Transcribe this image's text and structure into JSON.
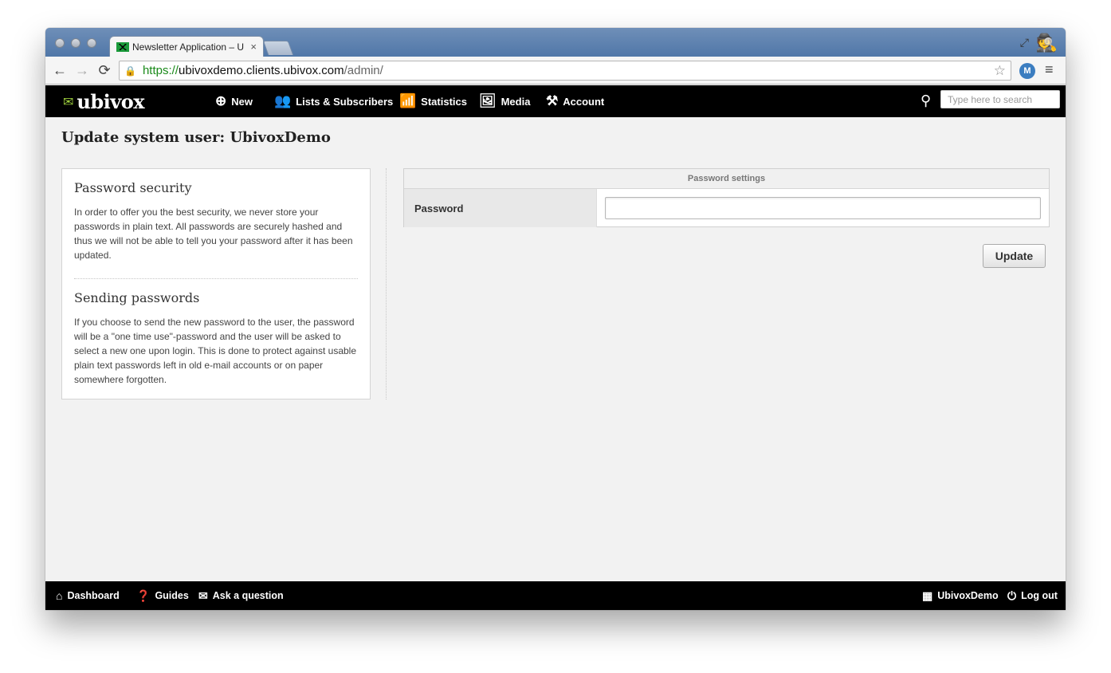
{
  "browser": {
    "tab_title": "Newsletter Application – U",
    "tab_close": "×",
    "url_scheme": "https://",
    "url_host": "ubivoxdemo.clients.ubivox.com",
    "url_path": "/admin/",
    "extension_label": "M"
  },
  "app": {
    "logo_text": "ubivox",
    "nav": [
      {
        "label": "New",
        "icon": "plus-circle-icon"
      },
      {
        "label": "Lists & Subscribers",
        "icon": "users-icon"
      },
      {
        "label": "Statistics",
        "icon": "bar-chart-icon"
      },
      {
        "label": "Media",
        "icon": "image-icon"
      },
      {
        "label": "Account",
        "icon": "tools-icon"
      }
    ],
    "search_placeholder": "Type here to search"
  },
  "page": {
    "title": "Update system user: UbivoxDemo",
    "info": {
      "security_title": "Password security",
      "security_text": "In order to offer you the best security, we never store your passwords in plain text. All passwords are securely hashed and thus we will not be able to tell you your password after it has been updated.",
      "sending_title": "Sending passwords",
      "sending_text": "If you choose to send the new password to the user, the password will be a \"one time use\"-password and the user will be asked to select a new one upon login. This is done to protect against usable plain text passwords left in old e-mail accounts or on paper somewhere forgotten."
    },
    "settings": {
      "header": "Password settings",
      "password_label": "Password",
      "password_value": ""
    },
    "update_label": "Update"
  },
  "footer": {
    "dashboard": "Dashboard",
    "guides": "Guides",
    "ask": "Ask a question",
    "user": "UbivoxDemo",
    "logout": "Log out"
  }
}
